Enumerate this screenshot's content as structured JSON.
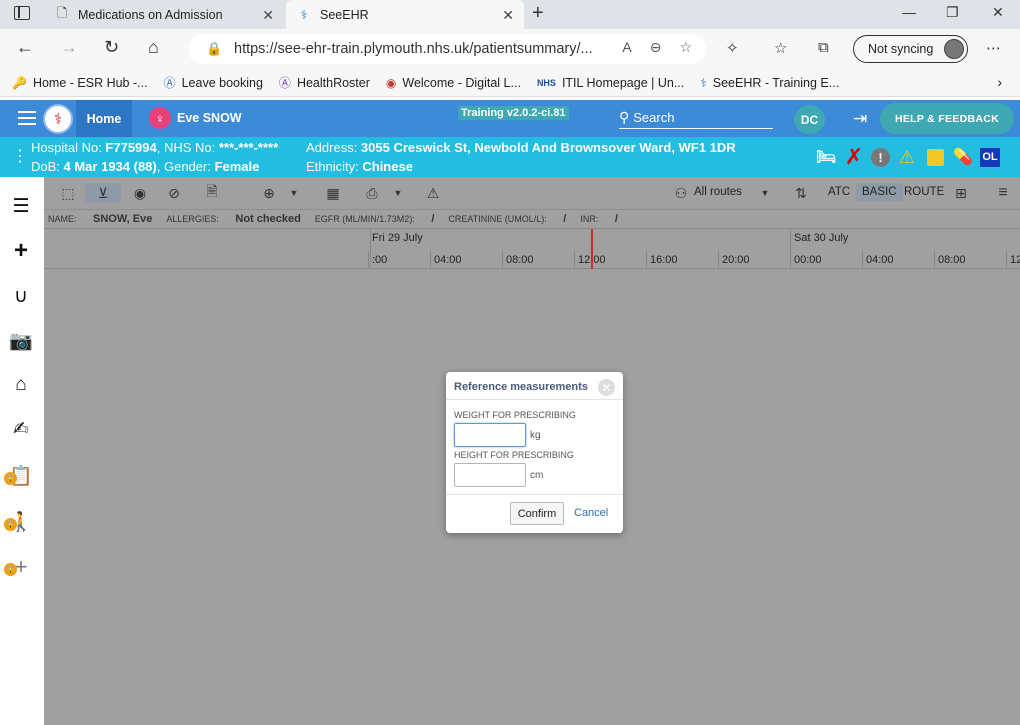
{
  "browser": {
    "tabs": [
      {
        "title": "Medications on Admission",
        "icon": "page-icon"
      },
      {
        "title": "SeeEHR",
        "icon": "seeehr-icon"
      }
    ],
    "url": "https://see-ehr-train.plymouth.nhs.uk/patientsummary/...",
    "sync_label": "Not syncing",
    "favorites": [
      {
        "label": "Home - ESR Hub -...",
        "icon": "key-icon"
      },
      {
        "label": "Leave booking",
        "icon": "leave-icon"
      },
      {
        "label": "HealthRoster",
        "icon": "healthroster-icon"
      },
      {
        "label": "Welcome - Digital L...",
        "icon": "globe-icon"
      },
      {
        "label": "ITIL Homepage | Un...",
        "icon": "nhs-icon"
      },
      {
        "label": "SeeEHR - Training E...",
        "icon": "seeehr-icon"
      }
    ]
  },
  "ehr": {
    "home_label": "Home",
    "patient_name": "Eve SNOW",
    "training_label": "Training v2.0.2-ci.81",
    "search_label": "Search",
    "user_initials": "DC",
    "help_label": "HELP & FEEDBACK"
  },
  "patient_bar": {
    "hospital_label": "Hospital No: ",
    "hospital_no": "F775994",
    "nhs_label": ", NHS No: ",
    "nhs_no": "***-***-****",
    "dob_label": "DoB: ",
    "dob": "4 Mar 1934 (88)",
    "gender_label": ", Gender: ",
    "gender": "Female",
    "address_label": "Address: ",
    "address": "3055 Creswick St, Newbold And Brownsover Ward, WF1 1DR",
    "ethnicity_label": "Ethnicity: ",
    "ethnicity": "Chinese",
    "ol_label": "OL"
  },
  "toolbar": {
    "routes_label": "All routes",
    "atc_label": "ATC",
    "basic_label": "BASIC",
    "route_label": "ROUTE"
  },
  "infoline": {
    "name_label": "NAME:",
    "name": "SNOW, Eve",
    "allergies_label": "ALLERGIES:",
    "allergies": "Not checked",
    "egfr_label": "EGFR (ML/MIN/1.73M2):",
    "egfr": "/",
    "creat_label": "CREATININE (UMOL/L):",
    "creat": "/",
    "inr_label": "INR:",
    "inr": "/"
  },
  "timeline": {
    "day1": "Fri 29 July",
    "day2": "Sat 30 July",
    "hours": [
      ":00",
      "04:00",
      "08:00",
      "12:00",
      "16:00",
      "20:00",
      "00:00",
      "04:00",
      "08:00",
      "12"
    ]
  },
  "modal": {
    "title": "Reference measurements",
    "weight_label": "WEIGHT FOR PRESCRIBING",
    "weight_value": "",
    "weight_unit": "kg",
    "height_label": "HEIGHT FOR PRESCRIBING",
    "height_value": "",
    "height_unit": "cm",
    "confirm_label": "Confirm",
    "cancel_label": "Cancel"
  }
}
